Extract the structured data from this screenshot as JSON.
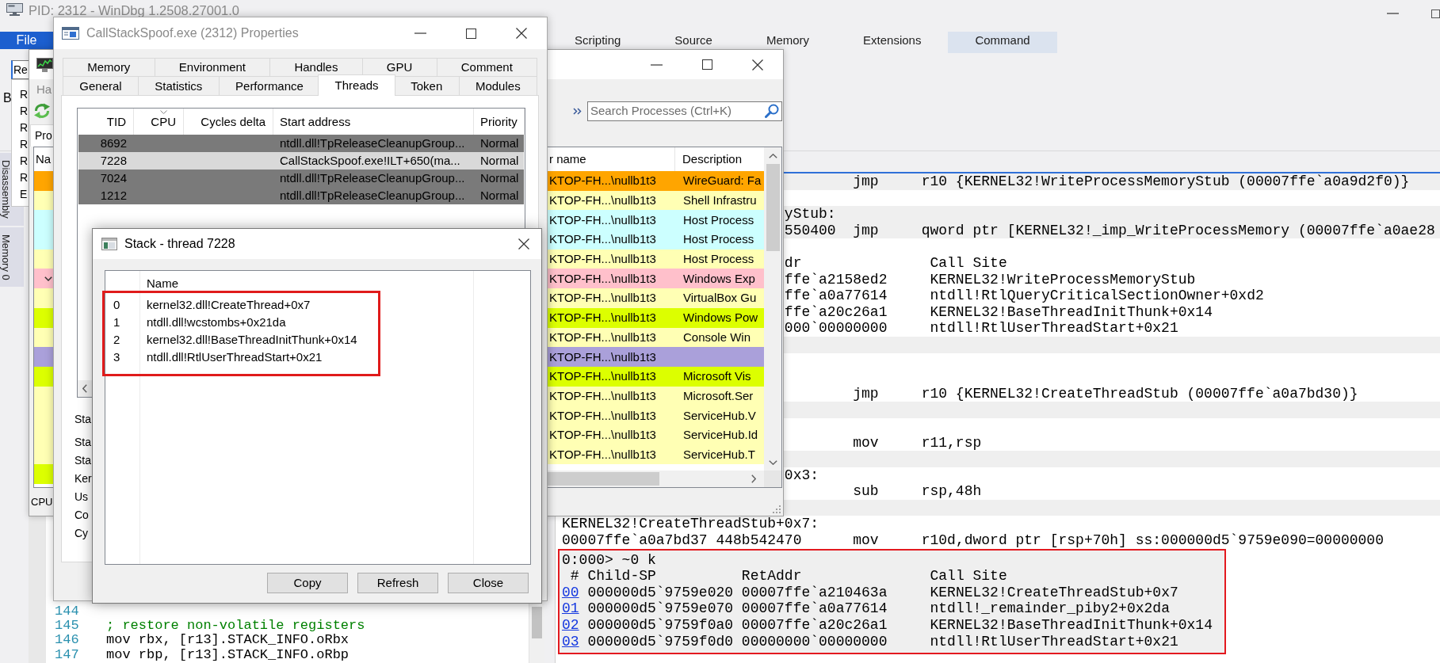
{
  "windbg": {
    "title": "PID: 2312 - WinDbg 1.2508.27001.0",
    "active": false,
    "ribbon_tabs": [
      {
        "label": "File",
        "kind": "file",
        "selected": false
      },
      {
        "label": "Scripting",
        "kind": "tab",
        "selected": false
      },
      {
        "label": "Source",
        "kind": "tab",
        "selected": false
      },
      {
        "label": "Memory",
        "kind": "tab",
        "selected": false
      },
      {
        "label": "Extensions",
        "kind": "tab",
        "selected": false
      },
      {
        "label": "Command",
        "kind": "tab",
        "selected": true
      }
    ],
    "ribbon": {
      "group_label": "B",
      "dropdown": {
        "value": "Re",
        "items": [
          "R",
          "R",
          "R",
          "R",
          "R",
          "R",
          "E"
        ]
      }
    },
    "side_tabs": [
      {
        "label": "Disassembly"
      },
      {
        "label": "Memory 0"
      }
    ],
    "command_window": {
      "lines": [
        {
          "kind": "instruction",
          "shaded": true,
          "mnemonic": "jmp",
          "operands": "r10 {KERNEL32!WriteProcessMemoryStub (00007ffe`a0a9d2f0)}"
        },
        {
          "kind": "blank",
          "shaded": false
        },
        {
          "kind": "tail",
          "shaded": true,
          "text": "yStub:"
        },
        {
          "kind": "instruction",
          "shaded": true,
          "tail": "550400",
          "mnemonic": "jmp",
          "operands": "qword ptr [KERNEL32!_imp_WriteProcessMemory (00007ffe`a0ae28"
        },
        {
          "kind": "blank",
          "shaded": false
        },
        {
          "kind": "frame",
          "shaded": false,
          "tail": "dr",
          "call_site": "Call Site"
        },
        {
          "kind": "frame",
          "shaded": false,
          "tail": "ffe`a2158ed2",
          "call_site": "KERNEL32!WriteProcessMemoryStub"
        },
        {
          "kind": "frame",
          "shaded": false,
          "tail": "ffe`a0a77614",
          "call_site": "ntdll!RtlQueryCriticalSectionOwner+0xd2"
        },
        {
          "kind": "frame",
          "shaded": false,
          "tail": "ffe`a20c26a1",
          "call_site": "KERNEL32!BaseThreadInitThunk+0x14"
        },
        {
          "kind": "frame",
          "shaded": false,
          "tail": "000`00000000",
          "call_site": "ntdll!RtlUserThreadStart+0x21"
        },
        {
          "kind": "blank",
          "shaded": true
        },
        {
          "kind": "blank",
          "shaded": false
        },
        {
          "kind": "blank",
          "shaded": false
        },
        {
          "kind": "instruction",
          "shaded": false,
          "mnemonic": "jmp",
          "operands": "r10 {KERNEL32!CreateThreadStub (00007ffe`a0a7bd30)}"
        },
        {
          "kind": "blank",
          "shaded": true
        },
        {
          "kind": "blank",
          "shaded": false
        },
        {
          "kind": "instruction",
          "shaded": false,
          "mnemonic": "mov",
          "operands": "r11,rsp"
        },
        {
          "kind": "blank",
          "shaded": true
        },
        {
          "kind": "tail",
          "shaded": false,
          "text": "0x3:"
        },
        {
          "kind": "instruction",
          "shaded": false,
          "mnemonic": "sub",
          "operands": "rsp,48h"
        },
        {
          "kind": "blank",
          "shaded": true
        },
        {
          "kind": "text",
          "shaded": false,
          "text": "KERNEL32!CreateThreadStub+0x7:"
        },
        {
          "kind": "instruction",
          "shaded": false,
          "address": "00007ffe`a0a7bd37",
          "bytes": "448b542470",
          "mnemonic": "mov",
          "operands": "r10d,dword ptr [rsp+70h] ss:000000d5`9759e090=00000000"
        }
      ],
      "stack_trace": {
        "highlighted": true,
        "shaded": true,
        "prompt": "0:000> ~0 k",
        "columns": [
          "#",
          "Child-SP",
          "RetAddr",
          "Call Site"
        ],
        "frames": [
          {
            "frame": "00",
            "child_sp": "000000d5`9759e020",
            "ret_addr": "00007ffe`a210463a",
            "call_site": "KERNEL32!CreateThreadStub+0x7"
          },
          {
            "frame": "01",
            "child_sp": "000000d5`9759e070",
            "ret_addr": "00007ffe`a0a77614",
            "call_site": "ntdll!_remainder_piby2+0x2da"
          },
          {
            "frame": "02",
            "child_sp": "000000d5`9759f0a0",
            "ret_addr": "00007ffe`a20c26a1",
            "call_site": "KERNEL32!BaseThreadInitThunk+0x14"
          },
          {
            "frame": "03",
            "child_sp": "000000d5`9759f0d0",
            "ret_addr": "00000000`00000000",
            "call_site": "ntdll!RtlUserThreadStart+0x21"
          }
        ]
      }
    },
    "editor": {
      "lines": [
        {
          "number": "144",
          "kind": "blank"
        },
        {
          "number": "145",
          "kind": "comment",
          "text": "; restore non-volatile registers"
        },
        {
          "number": "146",
          "kind": "code",
          "text": "mov rbx, [r13].STACK_INFO.oRbx"
        },
        {
          "number": "147",
          "kind": "code",
          "text": "mov rbp, [r13].STACK_INFO.oRbp"
        }
      ]
    }
  },
  "process_hacker": {
    "menu": [
      "Ha"
    ],
    "search": {
      "placeholder": "Search Processes (Ctrl+K)"
    },
    "tabs": [
      {
        "label": "Pro",
        "selected": true
      }
    ],
    "name_header": "Na",
    "columns": [
      "r name",
      "Description"
    ],
    "rows": [
      {
        "kind": "process",
        "color": "#ffa500",
        "user_name": "KTOP-FH...\\nullb1t3",
        "description": "WireGuard: Fa"
      },
      {
        "kind": "process",
        "color": "#ffffb4",
        "user_name": "KTOP-FH...\\nullb1t3",
        "description": "Shell Infrastru"
      },
      {
        "kind": "process",
        "color": "#ccffff",
        "user_name": "KTOP-FH...\\nullb1t3",
        "description": "Host Process"
      },
      {
        "kind": "process",
        "color": "#ccffff",
        "user_name": "KTOP-FH...\\nullb1t3",
        "description": "Host Process"
      },
      {
        "kind": "process",
        "color": "#ffffb4",
        "user_name": "KTOP-FH...\\nullb1t3",
        "description": "Host Process"
      },
      {
        "kind": "parent",
        "color": "#ffc0cb",
        "user_name": "KTOP-FH...\\nullb1t3",
        "description": "Windows Exp"
      },
      {
        "kind": "process",
        "color": "#ffffb4",
        "user_name": "KTOP-FH...\\nullb1t3",
        "description": "VirtualBox Gu"
      },
      {
        "kind": "process",
        "color": "#dcff00",
        "user_name": "KTOP-FH...\\nullb1t3",
        "description": "Windows Pow"
      },
      {
        "kind": "process",
        "color": "#ffffb4",
        "user_name": "KTOP-FH...\\nullb1t3",
        "description": "Console Win"
      },
      {
        "kind": "process",
        "color": "#aaa0da",
        "user_name": "KTOP-FH...\\nullb1t3"
      },
      {
        "kind": "process",
        "color": "#dcff00",
        "user_name": "KTOP-FH...\\nullb1t3",
        "description": "Microsoft Vis"
      },
      {
        "kind": "process",
        "color": "#ffffb4",
        "user_name": "KTOP-FH...\\nullb1t3",
        "description": "Microsoft.Ser"
      },
      {
        "kind": "process",
        "color": "#ffffb4",
        "user_name": "KTOP-FH...\\nullb1t3",
        "description": "ServiceHub.V"
      },
      {
        "kind": "process",
        "color": "#ffffb4",
        "user_name": "KTOP-FH...\\nullb1t3",
        "description": "ServiceHub.Id"
      },
      {
        "kind": "process",
        "color": "#ffffb4",
        "user_name": "KTOP-FH...\\nullb1t3",
        "description": "ServiceHub.T"
      },
      {
        "kind": "process",
        "color": "#dcff00"
      }
    ],
    "status_bar": "CPU"
  },
  "properties_window": {
    "title": "CallStackSpoof.exe (2312) Properties",
    "active": false,
    "tab_rows": [
      [
        {
          "label": "Memory",
          "selected": false
        },
        {
          "label": "Environment",
          "selected": false
        },
        {
          "label": "Handles",
          "selected": false
        },
        {
          "label": "GPU",
          "selected": false
        },
        {
          "label": "Comment",
          "selected": false
        }
      ],
      [
        {
          "label": "General",
          "selected": false
        },
        {
          "label": "Statistics",
          "selected": false
        },
        {
          "label": "Performance",
          "selected": false
        },
        {
          "label": "Threads",
          "selected": true
        },
        {
          "label": "Token",
          "selected": false
        },
        {
          "label": "Modules",
          "selected": false
        }
      ]
    ],
    "threads": {
      "columns": [
        {
          "label": "TID",
          "sorted": false
        },
        {
          "label": "CPU",
          "sorted": true
        },
        {
          "label": "Cycles delta",
          "sorted": false
        },
        {
          "label": "Start address",
          "sorted": false
        },
        {
          "label": "Priority",
          "sorted": false
        }
      ],
      "rows": [
        {
          "tid": "8692",
          "start_address": "ntdll.dll!TpReleaseCleanupGroup...",
          "priority": "Normal",
          "color": "#7a7a7a"
        },
        {
          "tid": "7228",
          "start_address": "CallStackSpoof.exe!ILT+650(ma...",
          "priority": "Normal",
          "color": "#d9d9d9"
        },
        {
          "tid": "7024",
          "start_address": "ntdll.dll!TpReleaseCleanupGroup...",
          "priority": "Normal",
          "color": "#7a7a7a"
        },
        {
          "tid": "1212",
          "start_address": "ntdll.dll!TpReleaseCleanupGroup...",
          "priority": "Normal",
          "color": "#7a7a7a"
        }
      ]
    },
    "field_labels": [
      "Sta",
      "Sta",
      "Sta",
      "Ker",
      "Us",
      "Co",
      "Cy"
    ]
  },
  "stack_window": {
    "title": "Stack - thread 7228",
    "active": true,
    "columns": [
      "Name"
    ],
    "highlighted": true,
    "frames": [
      {
        "index": "0",
        "name": "kernel32.dll!CreateThread+0x7"
      },
      {
        "index": "1",
        "name": "ntdll.dll!wcstombs+0x21da"
      },
      {
        "index": "2",
        "name": "kernel32.dll!BaseThreadInitThunk+0x14"
      },
      {
        "index": "3",
        "name": "ntdll.dll!RtlUserThreadStart+0x21"
      }
    ],
    "buttons": [
      "Copy",
      "Refresh",
      "Close"
    ]
  }
}
